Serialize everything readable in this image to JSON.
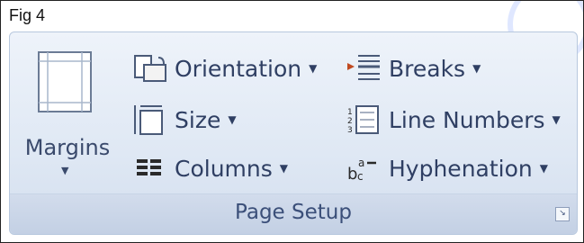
{
  "figure_label": "Fig 4",
  "group_title": "Page Setup",
  "margins": {
    "label": "Margins",
    "arrow": "▼"
  },
  "column1": [
    {
      "label": "Orientation",
      "icon": "orientation-icon",
      "dropdown": "▼"
    },
    {
      "label": "Size",
      "icon": "size-icon",
      "dropdown": "▼"
    },
    {
      "label": "Columns",
      "icon": "columns-icon",
      "dropdown": "▼"
    }
  ],
  "column2": [
    {
      "label": "Breaks",
      "icon": "breaks-icon",
      "dropdown": "▼"
    },
    {
      "label": "Line Numbers",
      "icon": "line-numbers-icon",
      "dropdown": "▼"
    },
    {
      "label": "Hyphenation",
      "icon": "hyphenation-icon",
      "dropdown": "▼"
    }
  ],
  "dialog_launcher": "↘",
  "colors": {
    "ribbon_text": "#2f3f63",
    "ribbon_bg": "#dfe8f4",
    "footer_bg": "#c9d5e8"
  }
}
